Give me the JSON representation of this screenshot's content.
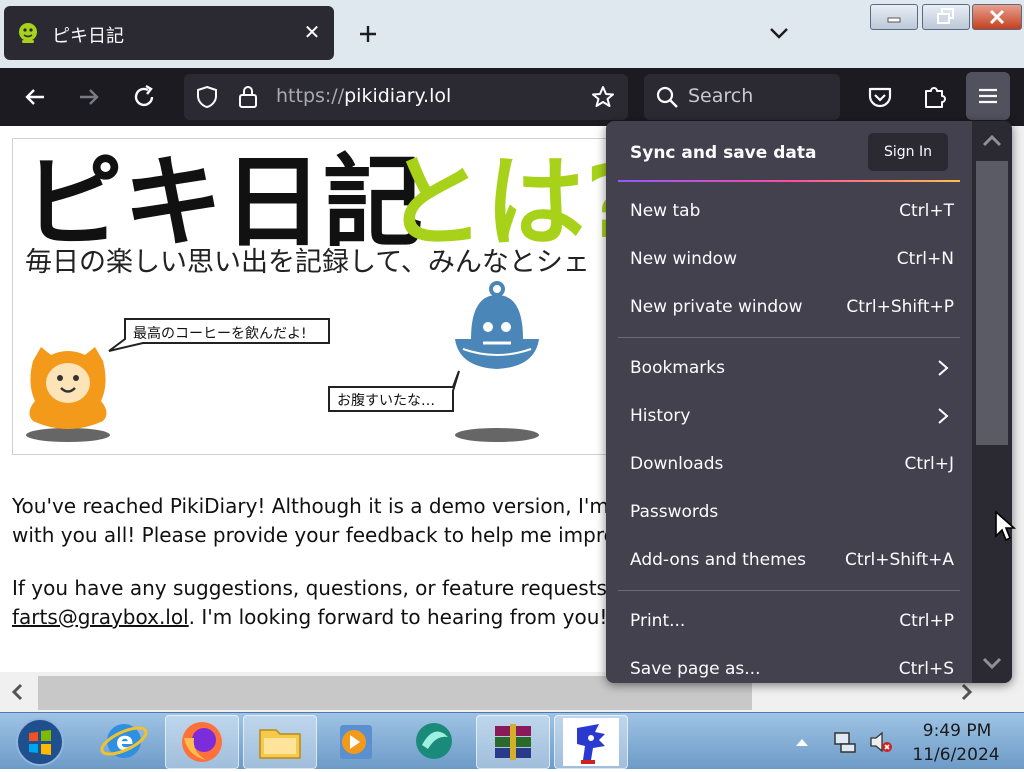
{
  "tab": {
    "title": "ピキ日記",
    "close_glyph": "✕"
  },
  "navbar": {
    "url_protocol": "https://",
    "url_host": "pikidiary.lol",
    "search_placeholder": "Search"
  },
  "banner": {
    "title_black": "ピキ日記",
    "title_green": "とは?",
    "subtitle": "毎日の楽しい思い出を記録して、みんなとシェ",
    "bubble_left": "最高のコーヒーを飲んだよ!",
    "bubble_right": "お腹すいたな…"
  },
  "page": {
    "para1_line1": "You've reached PikiDiary! Although it is a demo version, I'm",
    "para1_line2": "with you all! Please provide your feedback to help me impro",
    "para2_line1": "If you have any suggestions, questions, or feature requests,",
    "email": "farts@graybox.lol",
    "para2_rest": ". I'm looking forward to hearing from you!"
  },
  "app_menu": {
    "header_label": "Sync and save data",
    "sign_in_label": "Sign In",
    "items": [
      {
        "label": "New tab",
        "shortcut": "Ctrl+T"
      },
      {
        "label": "New window",
        "shortcut": "Ctrl+N"
      },
      {
        "label": "New private window",
        "shortcut": "Ctrl+Shift+P"
      },
      {
        "label": "Bookmarks",
        "shortcut": ""
      },
      {
        "label": "History",
        "shortcut": ""
      },
      {
        "label": "Downloads",
        "shortcut": "Ctrl+J"
      },
      {
        "label": "Passwords",
        "shortcut": ""
      },
      {
        "label": "Add-ons and themes",
        "shortcut": "Ctrl+Shift+A"
      },
      {
        "label": "Print...",
        "shortcut": "Ctrl+P"
      },
      {
        "label": "Save page as...",
        "shortcut": "Ctrl+S"
      }
    ]
  },
  "taskbar": {
    "time": "9:49 PM",
    "date": "11/6/2024",
    "icons": [
      "windows-start-icon",
      "internet-explorer-icon",
      "firefox-icon",
      "file-explorer-icon",
      "media-player-icon",
      "app-icon",
      "winrar-icon",
      "sonic-game-icon"
    ]
  },
  "colors": {
    "toolbar_bg": "#1c1b22",
    "menu_bg": "#42414d",
    "tabstrip_bg": "#dfe7ef",
    "banner_green": "#a8d21a",
    "character_orange": "#f39a1b",
    "character_blue": "#4a86b8"
  }
}
